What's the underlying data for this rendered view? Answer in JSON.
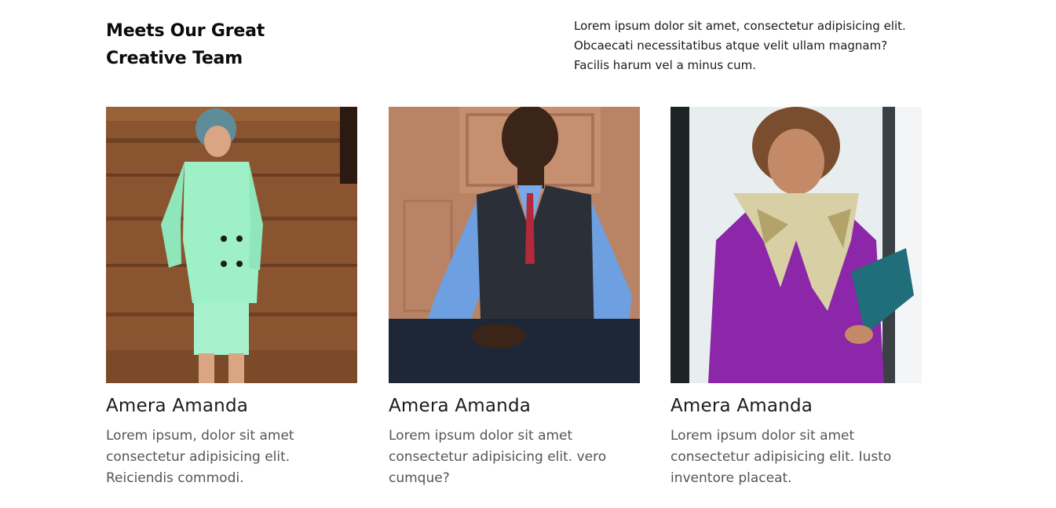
{
  "team": {
    "heading": "Meets Our Great Creative Team",
    "intro": "Lorem ipsum dolor sit amet, consectetur adipisicing elit. Obcaecati necessitatibus atque velit ullam magnam? Facilis harum vel a minus cum.",
    "members": [
      {
        "name": "Amera Amanda",
        "bio": "Lorem ipsum, dolor sit amet consectetur adipisicing elit. Reiciendis commodi."
      },
      {
        "name": "Amera Amanda",
        "bio": "Lorem ipsum dolor sit amet consectetur adipisicing elit. vero cumque?"
      },
      {
        "name": "Amera Amanda",
        "bio": "Lorem ipsum dolor sit amet consectetur adipisicing elit. Iusto inventore placeat."
      }
    ]
  }
}
